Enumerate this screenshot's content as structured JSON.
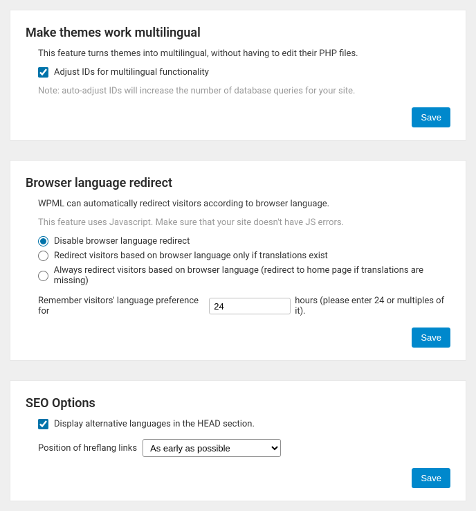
{
  "themes": {
    "heading": "Make themes work multilingual",
    "desc": "This feature turns themes into multilingual, without having to edit their PHP files.",
    "adjust_ids_label": "Adjust IDs for multilingual functionality",
    "adjust_ids_checked": true,
    "note": "Note: auto-adjust IDs will increase the number of database queries for your site.",
    "save_label": "Save"
  },
  "redirect": {
    "heading": "Browser language redirect",
    "desc": "WPML can automatically redirect visitors according to browser language.",
    "note": "This feature uses Javascript. Make sure that your site doesn't have JS errors.",
    "options": [
      "Disable browser language redirect",
      "Redirect visitors based on browser language only if translations exist",
      "Always redirect visitors based on browser language (redirect to home page if translations are missing)"
    ],
    "selected_option": 0,
    "remember_prefix": "Remember visitors' language preference for",
    "remember_value": "24",
    "remember_suffix": "hours (please enter 24 or multiples of it).",
    "save_label": "Save"
  },
  "seo": {
    "heading": "SEO Options",
    "alt_lang_label": "Display alternative languages in the HEAD section.",
    "alt_lang_checked": true,
    "hreflang_label": "Position of hreflang links",
    "hreflang_value": "As early as possible",
    "save_label": "Save"
  }
}
